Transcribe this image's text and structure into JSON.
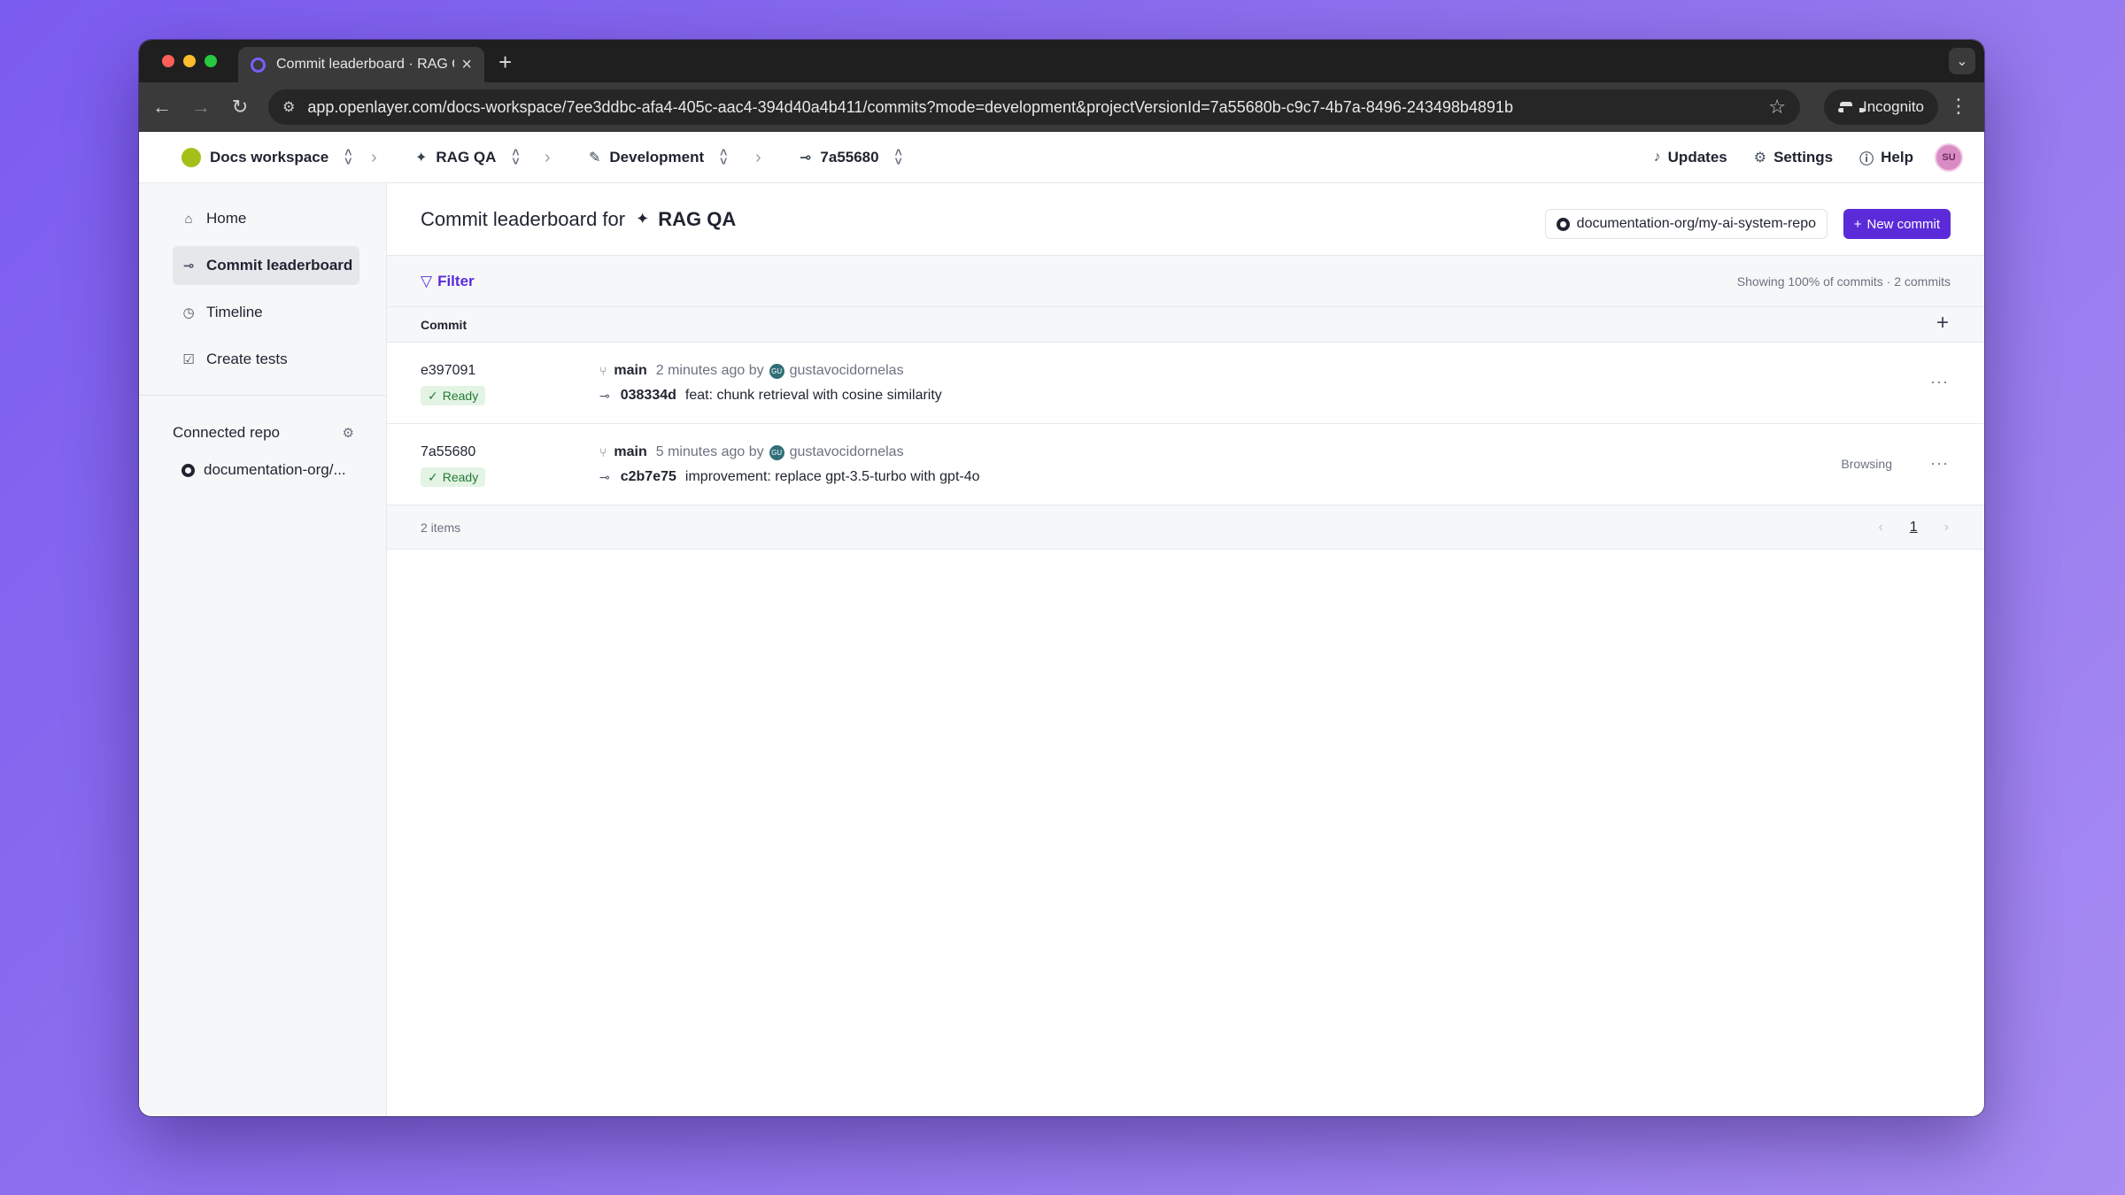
{
  "browser": {
    "tab_title": "Commit leaderboard · RAG QA",
    "url": "app.openlayer.com/docs-workspace/7ee3ddbc-afa4-405c-aac4-394d40a4b411/commits?mode=development&projectVersionId=7a55680b-c9c7-4b7a-8496-243498b4891b",
    "incognito_label": "Incognito"
  },
  "header": {
    "workspace": "Docs workspace",
    "project": "RAG QA",
    "mode": "Development",
    "commit": "7a55680",
    "updates": "Updates",
    "settings": "Settings",
    "help": "Help",
    "avatar_initials": "SU"
  },
  "sidebar": {
    "items": [
      {
        "label": "Home",
        "icon": "home-icon"
      },
      {
        "label": "Commit leaderboard",
        "icon": "commit-icon"
      },
      {
        "label": "Timeline",
        "icon": "clock-icon"
      },
      {
        "label": "Create tests",
        "icon": "checkbox-icon"
      }
    ],
    "connected_repo_label": "Connected repo",
    "repo_name": "documentation-org/..."
  },
  "main": {
    "title_prefix": "Commit leaderboard for",
    "title_project": "RAG QA",
    "repo_button": "documentation-org/my-ai-system-repo",
    "new_commit_button": "New commit",
    "filter_label": "Filter",
    "showing_text": "Showing 100% of commits · 2 commits",
    "column_commit": "Commit",
    "rows": [
      {
        "id": "e397091",
        "status": "Ready",
        "branch": "main",
        "time": "2 minutes ago by",
        "author_initials": "GU",
        "author": "gustavocidornelas",
        "sha": "038334d",
        "message": "feat: chunk retrieval with cosine similarity",
        "tag": ""
      },
      {
        "id": "7a55680",
        "status": "Ready",
        "branch": "main",
        "time": "5 minutes ago by",
        "author_initials": "GU",
        "author": "gustavocidornelas",
        "sha": "c2b7e75",
        "message": "improvement: replace gpt-3.5-turbo with gpt-4o",
        "tag": "Browsing"
      }
    ],
    "items_count": "2 items",
    "current_page": "1"
  },
  "colors": {
    "accent": "#5b2bd9",
    "ready_bg": "#e3f4e5",
    "ready_text": "#237a35",
    "workspace_dot": "#a3c01a"
  }
}
